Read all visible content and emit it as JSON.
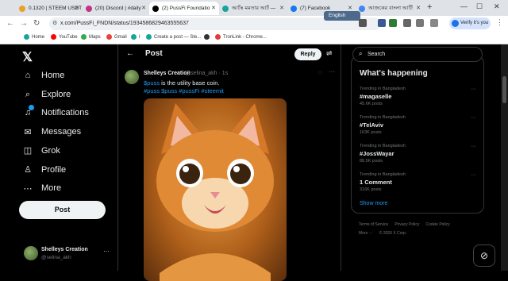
{
  "browser": {
    "tabs": [
      {
        "title": "0.1320 | STEEM USDT",
        "color": "#e9a128"
      },
      {
        "title": "(20) Discord | #daily",
        "color": "#c13584"
      },
      {
        "title": "(2) PussFi Foundatio",
        "color": "#000000"
      },
      {
        "title": "আর্টঃ মমতার আর্ট —",
        "color": "#1aa39a"
      },
      {
        "title": "(7) Facebook",
        "color": "#1877f2"
      },
      {
        "title": "আজকের বাংলা আর্টি",
        "color": "#4285f4"
      }
    ],
    "new_tab": "+",
    "win_minimize": "—",
    "win_maximize": "☐",
    "win_close": "✕",
    "url": "x.com/PussFi_FNDN/status/1934586829463555637",
    "language_pill": "English",
    "verify_label": "Verify it's you",
    "bookmarks": [
      {
        "label": "Home",
        "color": "#1aa39a"
      },
      {
        "label": "YouTube",
        "color": "#ff0000"
      },
      {
        "label": "Maps",
        "color": "#34a853"
      },
      {
        "label": "Gmail",
        "color": "#ea4335"
      },
      {
        "label": "I",
        "color": "#1aa39a"
      },
      {
        "label": "Create a post — Ste...",
        "color": "#1aa39a"
      },
      {
        "label": "",
        "color": "#333333"
      },
      {
        "label": "TronLink - Chrome...",
        "color": "#e23b3b"
      }
    ]
  },
  "nav": {
    "items": [
      {
        "label": "Home",
        "icon": "home-icon",
        "glyph": "⌂"
      },
      {
        "label": "Explore",
        "icon": "search-icon",
        "glyph": "⌕"
      },
      {
        "label": "Notifications",
        "icon": "bell-icon",
        "glyph": "♫"
      },
      {
        "label": "Messages",
        "icon": "mail-icon",
        "glyph": "✉"
      },
      {
        "label": "Grok",
        "icon": "grok-icon",
        "glyph": "◫"
      },
      {
        "label": "Profile",
        "icon": "person-icon",
        "glyph": "♙"
      },
      {
        "label": "More",
        "icon": "more-circle-icon",
        "glyph": "⋯"
      }
    ],
    "post_button": "Post",
    "account": {
      "name": "Shelleys Creation",
      "handle": "@selina_akh"
    }
  },
  "main": {
    "title": "Post",
    "reply_button": "Reply",
    "tweet": {
      "author": "Shelleys Creation",
      "meta": "@selina_akh · 1s",
      "cashtag": "$puss",
      "text_rest": " is the utility base coin.",
      "hashtags": "#puss $puss #pussFi #steemit"
    }
  },
  "right": {
    "search_placeholder": "Search",
    "trends_title": "What's happening",
    "trends": [
      {
        "context": "Trending in Bangladesh",
        "topic": "#magaselle",
        "count": "45.6K posts"
      },
      {
        "context": "Trending in Bangladesh",
        "topic": "#TelAviv",
        "count": "163K posts"
      },
      {
        "context": "Trending in Bangladesh",
        "topic": "#JossWayar",
        "count": "88.5K posts"
      },
      {
        "context": "Trending in Bangladesh",
        "topic": "1 Comment",
        "count": "316K posts"
      }
    ],
    "show_more": "Show more",
    "footer_line1": [
      "Terms of Service",
      "Privacy Policy",
      "Cookie Policy"
    ],
    "footer_line2": [
      "More ···",
      "© 2026 X Corp."
    ]
  }
}
